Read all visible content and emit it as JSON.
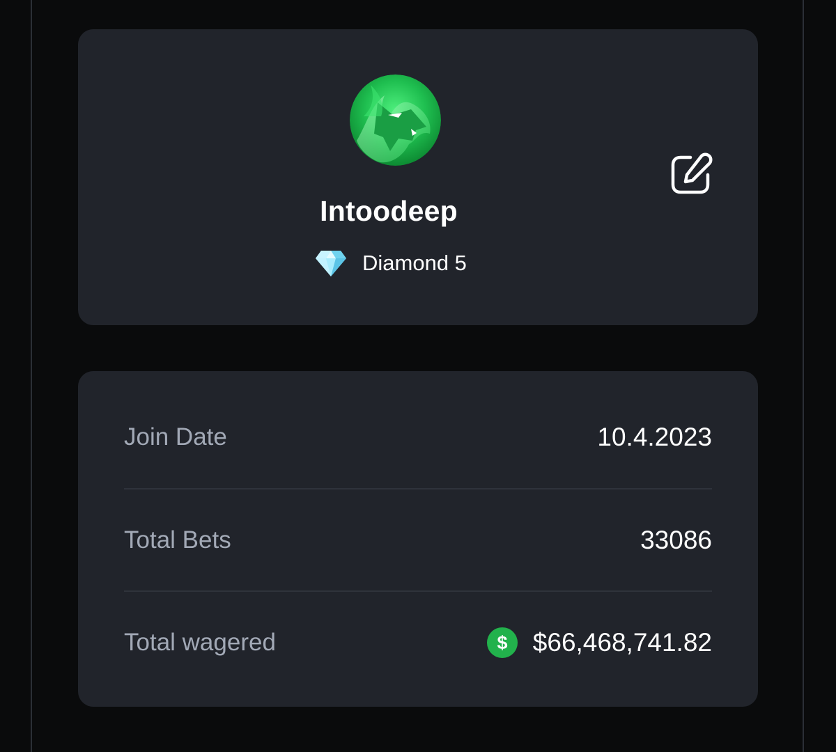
{
  "profile": {
    "username": "Intoodeep",
    "rank": {
      "label": "Diamond 5",
      "icon": "diamond-icon"
    },
    "avatar_icon": "green-wolf-avatar",
    "edit_icon": "edit-icon"
  },
  "stats": {
    "rows": [
      {
        "label": "Join Date",
        "value": "10.4.2023"
      },
      {
        "label": "Total Bets",
        "value": "33086"
      },
      {
        "label": "Total wagered",
        "value": "$66,468,741.82",
        "icon": "dollar-coin-icon"
      }
    ]
  },
  "colors": {
    "page_bg": "#0a0b0c",
    "card_bg": "#21242b",
    "label_gray": "#a2a9b6",
    "accent_green": "#22b24c",
    "diamond_blue": "#8fe3f8"
  }
}
